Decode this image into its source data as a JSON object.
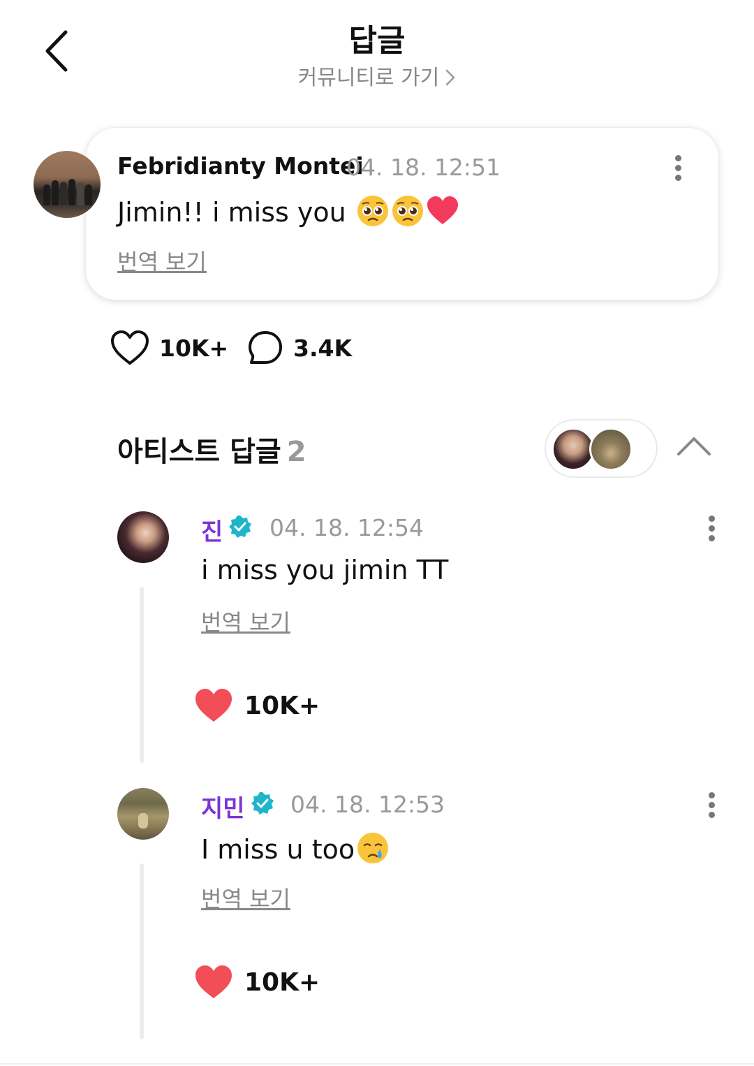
{
  "header": {
    "title": "답글",
    "community_link": "커뮤니티로 가기",
    "back_icon": "chevron-left-icon"
  },
  "post": {
    "author": "Febridianty Montei",
    "time": "04. 18. 12:51",
    "text": "Jimin!! i miss you",
    "emojis": [
      "pleading-face",
      "pleading-face",
      "red-heart"
    ],
    "translate": "번역 보기",
    "likes": "10K+",
    "comments": "3.4K"
  },
  "artist_replies": {
    "title": "아티스트 답글",
    "count": "2",
    "replies": [
      {
        "name": "진",
        "verified": true,
        "time": "04. 18. 12:54",
        "text": "i miss you jimin TT",
        "translate": "번역 보기",
        "likes": "10K+"
      },
      {
        "name": "지민",
        "verified": true,
        "time": "04. 18. 12:53",
        "text": "I miss u too",
        "emoji": "crying-face",
        "translate": "번역 보기",
        "likes": "10K+"
      }
    ]
  },
  "colors": {
    "artist_name": "#7b35d6",
    "verified_badge": "#1fb5c9",
    "like_heart": "#f24e58",
    "muted_text": "#999999"
  }
}
